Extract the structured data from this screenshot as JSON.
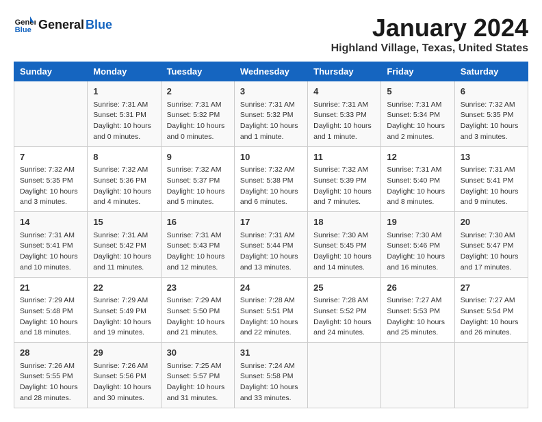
{
  "header": {
    "logo_line1": "General",
    "logo_line2": "Blue",
    "month_title": "January 2024",
    "location": "Highland Village, Texas, United States"
  },
  "days_of_week": [
    "Sunday",
    "Monday",
    "Tuesday",
    "Wednesday",
    "Thursday",
    "Friday",
    "Saturday"
  ],
  "weeks": [
    [
      {
        "day": "",
        "info": ""
      },
      {
        "day": "1",
        "info": "Sunrise: 7:31 AM\nSunset: 5:31 PM\nDaylight: 10 hours\nand 0 minutes."
      },
      {
        "day": "2",
        "info": "Sunrise: 7:31 AM\nSunset: 5:32 PM\nDaylight: 10 hours\nand 0 minutes."
      },
      {
        "day": "3",
        "info": "Sunrise: 7:31 AM\nSunset: 5:32 PM\nDaylight: 10 hours\nand 1 minute."
      },
      {
        "day": "4",
        "info": "Sunrise: 7:31 AM\nSunset: 5:33 PM\nDaylight: 10 hours\nand 1 minute."
      },
      {
        "day": "5",
        "info": "Sunrise: 7:31 AM\nSunset: 5:34 PM\nDaylight: 10 hours\nand 2 minutes."
      },
      {
        "day": "6",
        "info": "Sunrise: 7:32 AM\nSunset: 5:35 PM\nDaylight: 10 hours\nand 3 minutes."
      }
    ],
    [
      {
        "day": "7",
        "info": "Sunrise: 7:32 AM\nSunset: 5:35 PM\nDaylight: 10 hours\nand 3 minutes."
      },
      {
        "day": "8",
        "info": "Sunrise: 7:32 AM\nSunset: 5:36 PM\nDaylight: 10 hours\nand 4 minutes."
      },
      {
        "day": "9",
        "info": "Sunrise: 7:32 AM\nSunset: 5:37 PM\nDaylight: 10 hours\nand 5 minutes."
      },
      {
        "day": "10",
        "info": "Sunrise: 7:32 AM\nSunset: 5:38 PM\nDaylight: 10 hours\nand 6 minutes."
      },
      {
        "day": "11",
        "info": "Sunrise: 7:32 AM\nSunset: 5:39 PM\nDaylight: 10 hours\nand 7 minutes."
      },
      {
        "day": "12",
        "info": "Sunrise: 7:31 AM\nSunset: 5:40 PM\nDaylight: 10 hours\nand 8 minutes."
      },
      {
        "day": "13",
        "info": "Sunrise: 7:31 AM\nSunset: 5:41 PM\nDaylight: 10 hours\nand 9 minutes."
      }
    ],
    [
      {
        "day": "14",
        "info": "Sunrise: 7:31 AM\nSunset: 5:41 PM\nDaylight: 10 hours\nand 10 minutes."
      },
      {
        "day": "15",
        "info": "Sunrise: 7:31 AM\nSunset: 5:42 PM\nDaylight: 10 hours\nand 11 minutes."
      },
      {
        "day": "16",
        "info": "Sunrise: 7:31 AM\nSunset: 5:43 PM\nDaylight: 10 hours\nand 12 minutes."
      },
      {
        "day": "17",
        "info": "Sunrise: 7:31 AM\nSunset: 5:44 PM\nDaylight: 10 hours\nand 13 minutes."
      },
      {
        "day": "18",
        "info": "Sunrise: 7:30 AM\nSunset: 5:45 PM\nDaylight: 10 hours\nand 14 minutes."
      },
      {
        "day": "19",
        "info": "Sunrise: 7:30 AM\nSunset: 5:46 PM\nDaylight: 10 hours\nand 16 minutes."
      },
      {
        "day": "20",
        "info": "Sunrise: 7:30 AM\nSunset: 5:47 PM\nDaylight: 10 hours\nand 17 minutes."
      }
    ],
    [
      {
        "day": "21",
        "info": "Sunrise: 7:29 AM\nSunset: 5:48 PM\nDaylight: 10 hours\nand 18 minutes."
      },
      {
        "day": "22",
        "info": "Sunrise: 7:29 AM\nSunset: 5:49 PM\nDaylight: 10 hours\nand 19 minutes."
      },
      {
        "day": "23",
        "info": "Sunrise: 7:29 AM\nSunset: 5:50 PM\nDaylight: 10 hours\nand 21 minutes."
      },
      {
        "day": "24",
        "info": "Sunrise: 7:28 AM\nSunset: 5:51 PM\nDaylight: 10 hours\nand 22 minutes."
      },
      {
        "day": "25",
        "info": "Sunrise: 7:28 AM\nSunset: 5:52 PM\nDaylight: 10 hours\nand 24 minutes."
      },
      {
        "day": "26",
        "info": "Sunrise: 7:27 AM\nSunset: 5:53 PM\nDaylight: 10 hours\nand 25 minutes."
      },
      {
        "day": "27",
        "info": "Sunrise: 7:27 AM\nSunset: 5:54 PM\nDaylight: 10 hours\nand 26 minutes."
      }
    ],
    [
      {
        "day": "28",
        "info": "Sunrise: 7:26 AM\nSunset: 5:55 PM\nDaylight: 10 hours\nand 28 minutes."
      },
      {
        "day": "29",
        "info": "Sunrise: 7:26 AM\nSunset: 5:56 PM\nDaylight: 10 hours\nand 30 minutes."
      },
      {
        "day": "30",
        "info": "Sunrise: 7:25 AM\nSunset: 5:57 PM\nDaylight: 10 hours\nand 31 minutes."
      },
      {
        "day": "31",
        "info": "Sunrise: 7:24 AM\nSunset: 5:58 PM\nDaylight: 10 hours\nand 33 minutes."
      },
      {
        "day": "",
        "info": ""
      },
      {
        "day": "",
        "info": ""
      },
      {
        "day": "",
        "info": ""
      }
    ]
  ]
}
